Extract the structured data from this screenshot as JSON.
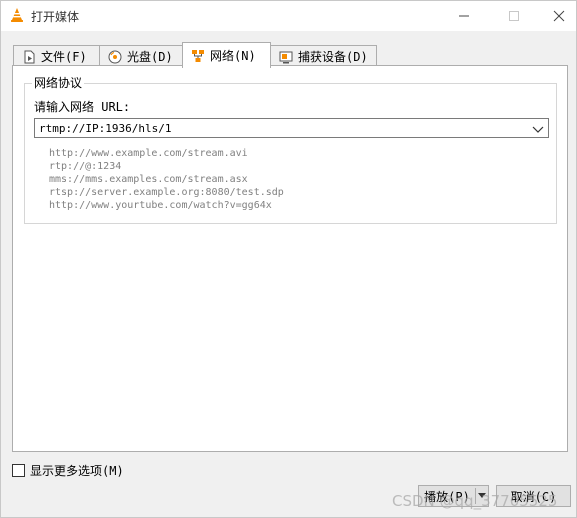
{
  "window": {
    "title": "打开媒体",
    "icon": "vlc-cone-icon"
  },
  "tabs": [
    {
      "label": "文件(F)",
      "icon": "file-icon",
      "active": false
    },
    {
      "label": "光盘(D)",
      "icon": "disc-icon",
      "active": false
    },
    {
      "label": "网络(N)",
      "icon": "network-icon",
      "active": true
    },
    {
      "label": "捕获设备(D)",
      "icon": "capture-device-icon",
      "active": false
    }
  ],
  "network": {
    "group_title": "网络协议",
    "url_label": "请输入网络 URL:",
    "url_value": "rtmp://IP:1936/hls/1",
    "examples": [
      "http://www.example.com/stream.avi",
      "rtp://@:1234",
      "mms://mms.examples.com/stream.asx",
      "rtsp://server.example.org:8080/test.sdp",
      "http://www.yourtube.com/watch?v=gg64x"
    ]
  },
  "footer": {
    "more_options_label": "显示更多选项(M)",
    "more_options_checked": false,
    "play_label": "播放(P)",
    "cancel_label": "取消(C)"
  },
  "watermark": "CSDN @qq_37705525",
  "colors": {
    "vlc_orange": "#f48b00",
    "example_gray": "#808080"
  }
}
